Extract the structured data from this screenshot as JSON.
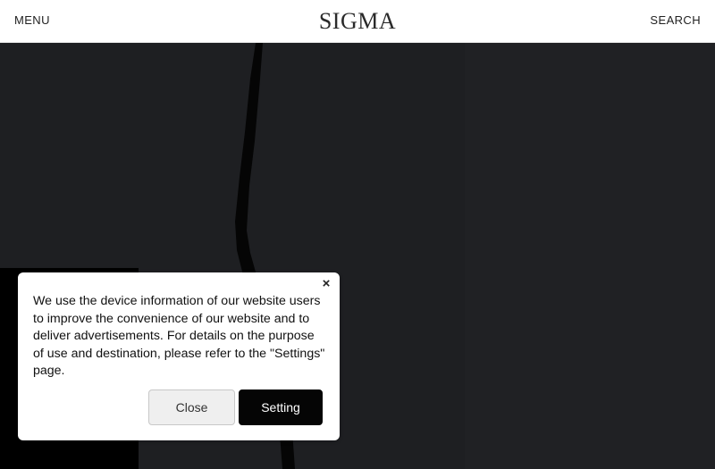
{
  "header": {
    "menu_label": "MENU",
    "logo_text": "SIGMA",
    "search_label": "SEARCH"
  },
  "cookie_banner": {
    "close_icon": "×",
    "message": "We use the device information of our website users to improve the convenience of our website and to deliver advertisements. For details on the purpose of use and destination, please refer to the \"Settings\" page.",
    "close_button_label": "Close",
    "setting_button_label": "Setting"
  },
  "colors": {
    "header_bg": "#ffffff",
    "hero_bg": "#1d1e21",
    "setting_button_bg": "#050505",
    "close_button_bg": "#efefef"
  },
  "icons": {
    "close": "close-icon"
  }
}
